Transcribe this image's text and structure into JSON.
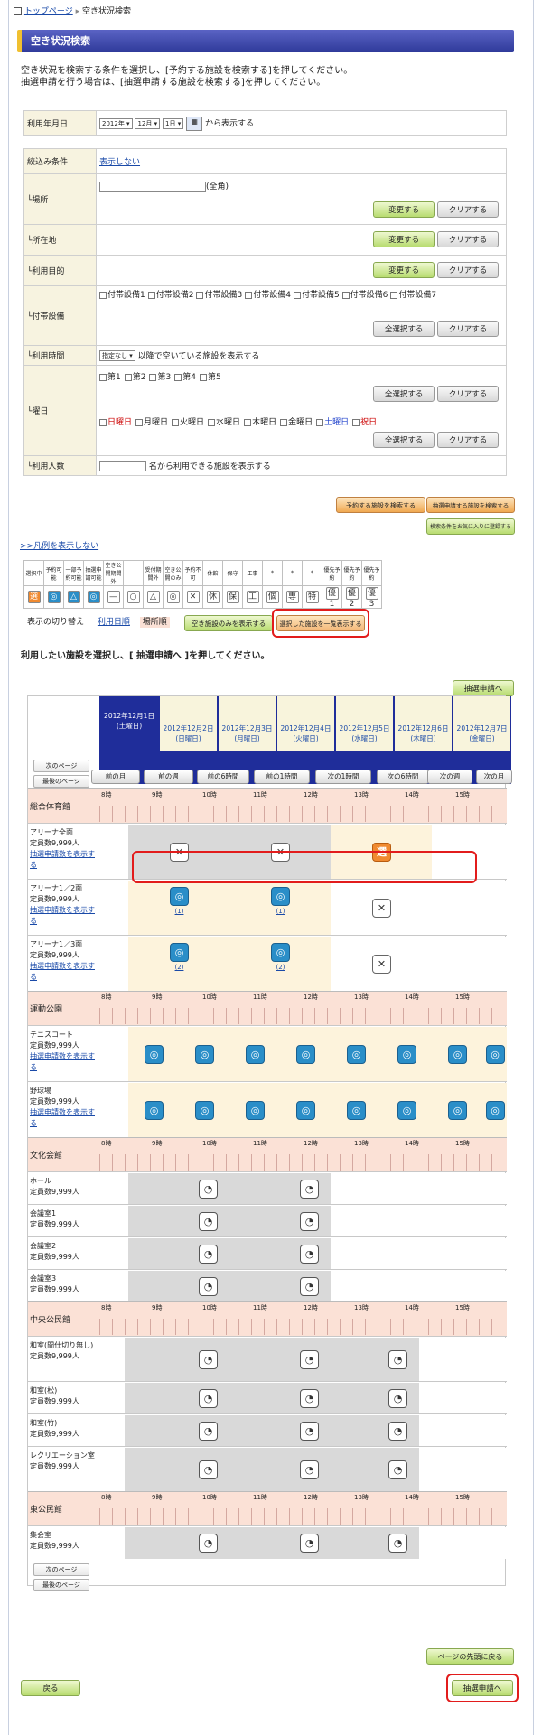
{
  "breadcrumb": {
    "home": "トップページ",
    "current": "空き状況検索"
  },
  "title": "空き状況検索",
  "intro": [
    "空き状況を検索する条件を選択し、[予約する施設を検索する]を押してください。",
    "抽選申請を行う場合は、[抽選申請する施設を検索する]を押してください。"
  ],
  "date": {
    "label": "利用年月日",
    "year": "2012年",
    "month": "12月",
    "day": "1日",
    "suffix": "から表示する"
  },
  "filter": {
    "label": "絞込み条件",
    "toggle": "表示しない"
  },
  "place": {
    "label": "└場所",
    "note": "(全角)"
  },
  "location": {
    "label": "└所在地"
  },
  "purpose": {
    "label": "└利用目的"
  },
  "equip": {
    "label": "└付帯設備",
    "items": [
      "付帯設備1",
      "付帯設備2",
      "付帯設備3",
      "付帯設備4",
      "付帯設備5",
      "付帯設備6",
      "付帯設備7"
    ]
  },
  "time": {
    "label": "└利用時間",
    "select": "指定なし",
    "suffix": "以降で空いている施設を表示する"
  },
  "weekday": {
    "label": "└曜日",
    "weeks": [
      "第1",
      "第2",
      "第3",
      "第4",
      "第5"
    ],
    "days": [
      "日曜日",
      "月曜日",
      "火曜日",
      "水曜日",
      "木曜日",
      "金曜日",
      "土曜日",
      "祝日"
    ]
  },
  "people": {
    "label": "└利用人数",
    "suffix": "名から利用できる施設を表示する"
  },
  "buttons": {
    "change": "変更する",
    "clear": "クリアする",
    "all": "全選択する",
    "search_reserve": "予約する施設を検索する",
    "search_lottery": "抽選申請する施設を検索する",
    "save_fav": "検索条件をお気に入りに登録する",
    "show_empty": "空き施設のみを表示する",
    "show_selected": "選択した施設を一覧表示する",
    "lottery": "抽選申請へ",
    "top": "ページの先頭に戻る",
    "back": "戻る",
    "next_page": "次のページ",
    "last_page": "最後のページ"
  },
  "legend": {
    "toggle": ">>凡例を表示しない",
    "heads": [
      "選択中",
      "予約可能",
      "一部予約可能",
      "抽選申請可能",
      "空き公開期間外",
      "",
      "受付期間外",
      "空き公開のみ",
      "予約不可",
      "休館",
      "保守",
      "工事",
      "*",
      "*",
      "*",
      "優先予約",
      "優先予約",
      "優先予約"
    ],
    "symbols": [
      "選",
      "◎",
      "△",
      "◎",
      "—",
      "○",
      "△",
      "◎",
      "✕",
      "休",
      "保",
      "工",
      "個",
      "専",
      "特",
      "優1",
      "優2",
      "優3"
    ]
  },
  "switch": {
    "label": "表示の切り替え",
    "opt1": "利用日順",
    "opt2": "場所順"
  },
  "instr": "利用したい施設を選択し、[ 抽選申請へ ]を押してください。",
  "days": [
    "2012年12月1日(土曜日)",
    "2012年12月2日(日曜日)",
    "2012年12月3日(月曜日)",
    "2012年12月4日(火曜日)",
    "2012年12月5日(水曜日)",
    "2012年12月6日(木曜日)",
    "2012年12月7日(金曜日)"
  ],
  "nav": [
    "前の月",
    "前の週",
    "前の6時間",
    "前の1時間",
    "次の1時間",
    "次の6時間",
    "次の週",
    "次の月"
  ],
  "hours": [
    "8時",
    "9時",
    "10時",
    "11時",
    "12時",
    "13時",
    "14時",
    "15時"
  ],
  "sections": [
    {
      "name": "総合体育館",
      "facilities": [
        {
          "name": "アリーナ全面",
          "cap": "定員数9,999人",
          "link": "抽選申請数を表示する"
        },
        {
          "name": "アリーナ1／2面",
          "cap": "定員数9,999人",
          "link": "抽選申請数を表示する",
          "counts": [
            "(1)",
            "(1)"
          ]
        },
        {
          "name": "アリーナ1／3面",
          "cap": "定員数9,999人",
          "link": "抽選申請数を表示する",
          "counts": [
            "(2)",
            "(2)"
          ]
        }
      ]
    },
    {
      "name": "運動公園",
      "facilities": [
        {
          "name": "テニスコート",
          "cap": "定員数9,999人",
          "link": "抽選申請数を表示する"
        },
        {
          "name": "野球場",
          "cap": "定員数9,999人",
          "link": "抽選申請数を表示する"
        }
      ]
    },
    {
      "name": "文化会館",
      "facilities": [
        {
          "name": "ホール",
          "cap": "定員数9,999人"
        },
        {
          "name": "会議室1",
          "cap": "定員数9,999人"
        },
        {
          "name": "会議室2",
          "cap": "定員数9,999人"
        },
        {
          "name": "会議室3",
          "cap": "定員数9,999人"
        }
      ]
    },
    {
      "name": "中央公民館",
      "facilities": [
        {
          "name": "和室(間仕切り無し)",
          "cap": "定員数9,999人"
        },
        {
          "name": "和室(松)",
          "cap": "定員数9,999人"
        },
        {
          "name": "和室(竹)",
          "cap": "定員数9,999人"
        },
        {
          "name": "レクリエーション室",
          "cap": "定員数9,999人"
        }
      ]
    },
    {
      "name": "東公民館",
      "facilities": [
        {
          "name": "集会室",
          "cap": "定員数9,999人"
        }
      ]
    }
  ],
  "icons": {
    "x": "✕",
    "sen": "選",
    "ok": "◎",
    "pr": "◔"
  },
  "colors": {
    "accent": "#3a45b0",
    "highlight": "#e21c1c",
    "header_bg": "#fbe1d6",
    "available": "#fdf3dc",
    "gray": "#d9d9d9"
  }
}
